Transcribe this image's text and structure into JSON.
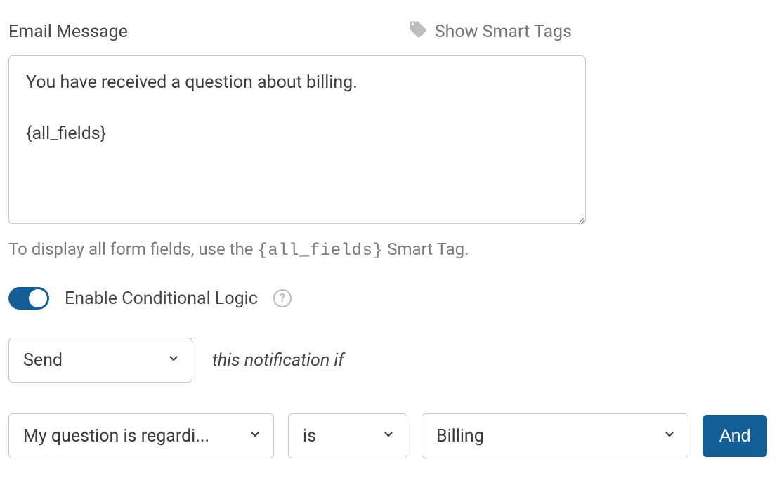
{
  "emailMessage": {
    "label": "Email Message",
    "smartTagsLink": "Show Smart Tags",
    "value": "You have received a question about billing.\n\n{all_fields}",
    "helperPrefix": "To display all form fields, use the ",
    "helperCode": "{all_fields}",
    "helperSuffix": " Smart Tag."
  },
  "conditional": {
    "toggleLabel": "Enable Conditional Logic",
    "enabled": true,
    "actionSelect": "Send",
    "actionSuffix": "this notification if",
    "rule": {
      "field": "My question is regardi...",
      "operator": "is",
      "value": "Billing"
    },
    "andButton": "And"
  }
}
